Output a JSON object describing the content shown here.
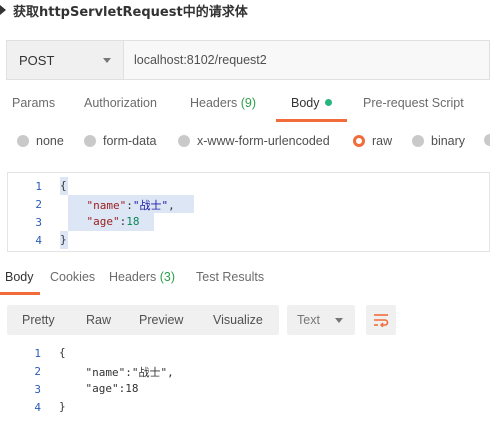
{
  "heading": {
    "title": "获取httpServletRequest中的请求体"
  },
  "request": {
    "method": "POST",
    "url": "localhost:8102/request2"
  },
  "request_tabs": [
    {
      "label": "Params"
    },
    {
      "label": "Authorization"
    },
    {
      "label": "Headers",
      "count": "(9)"
    },
    {
      "label": "Body",
      "active": true
    },
    {
      "label": "Pre-request Script"
    }
  ],
  "body_types": [
    {
      "label": "none"
    },
    {
      "label": "form-data"
    },
    {
      "label": "x-www-form-urlencoded"
    },
    {
      "label": "raw",
      "selected": true
    },
    {
      "label": "binary"
    }
  ],
  "request_body": {
    "line_numbers": [
      "1",
      "2",
      "3",
      "4"
    ],
    "lines": [
      "{",
      "    \"name\":\"战士\",",
      "    \"age\":18",
      "}"
    ],
    "brace_open": "{",
    "brace_close": "}",
    "key_name": "\"name\"",
    "val_name": "\"战士\"",
    "key_age": "\"age\"",
    "val_age": "18"
  },
  "response_tabs": [
    {
      "label": "Body",
      "active": true
    },
    {
      "label": "Cookies"
    },
    {
      "label": "Headers",
      "count": "(3)"
    },
    {
      "label": "Test Results"
    }
  ],
  "view_modes": [
    "Pretty",
    "Raw",
    "Preview",
    "Visualize"
  ],
  "format_select": {
    "value": "Text"
  },
  "wrap_icon": "wrap-lines-icon",
  "response_body": {
    "line_numbers": [
      "1",
      "2",
      "3",
      "4"
    ],
    "lines": [
      "{",
      "    \"name\":\"战士\",",
      "    \"age\":18",
      "}"
    ]
  },
  "colors": {
    "accent": "#f26b3a",
    "count_green": "#2e9e4b",
    "dot_green": "#26b47f",
    "line_number_blue": "#2a5bb7",
    "selection": "#dde6f5"
  }
}
